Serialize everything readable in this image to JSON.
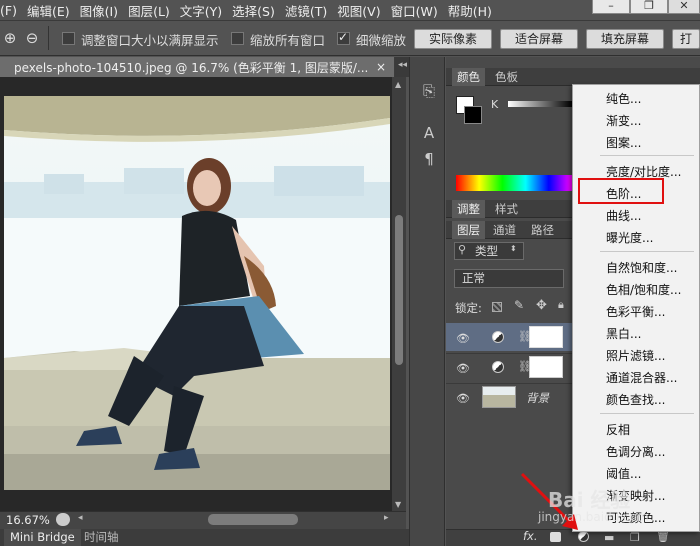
{
  "menubar": {
    "items": [
      "(F)",
      "编辑(E)",
      "图像(I)",
      "图层(L)",
      "文字(Y)",
      "选择(S)",
      "滤镜(T)",
      "视图(V)",
      "窗口(W)",
      "帮助(H)"
    ]
  },
  "window_buttons": [
    "–",
    "❐",
    "✕"
  ],
  "options_bar": {
    "resize_window_label": "调整窗口大小以满屏显示",
    "resize_window_checked": false,
    "zoom_all_label": "缩放所有窗口",
    "zoom_all_checked": false,
    "scrubby_zoom_label": "细微缩放",
    "scrubby_zoom_checked": true,
    "actual_pixels": "实际像素",
    "fit_screen": "适合屏幕",
    "fill_screen": "填充屏幕",
    "print_size": "打"
  },
  "document": {
    "tab_title": "pexels-photo-104510.jpeg @ 16.7% (色彩平衡 1, 图层蒙版/...",
    "close": "×",
    "zoom": "16.67%"
  },
  "bottom_tabs": [
    "Mini Bridge",
    "时间轴"
  ],
  "panels": {
    "color_tabs": [
      "颜色",
      "色板"
    ],
    "color_channel": "K",
    "adjust_tabs": [
      "调整",
      "样式"
    ],
    "layers_tabs": [
      "图层",
      "通道",
      "路径"
    ],
    "filter_kind": "类型",
    "blend_mode": "正常",
    "lock_label": "锁定:",
    "layers": [
      {
        "name": "",
        "type": "adjustment-with-mask",
        "selected": true
      },
      {
        "name": "",
        "type": "adjustment-with-mask",
        "selected": false
      },
      {
        "name": "背景",
        "type": "image",
        "selected": false
      }
    ],
    "footer_fx": "fx."
  },
  "adjustment_menu": {
    "groups": [
      [
        "纯色...",
        "渐变...",
        "图案..."
      ],
      [
        "亮度/对比度...",
        "色阶...",
        "曲线...",
        "曝光度..."
      ],
      [
        "自然饱和度...",
        "色相/饱和度...",
        "色彩平衡...",
        "黑白...",
        "照片滤镜...",
        "通道混合器...",
        "颜色查找..."
      ],
      [
        "反相",
        "色调分离...",
        "阈值...",
        "渐变映射...",
        "可选颜色..."
      ]
    ],
    "highlighted": "色阶..."
  },
  "watermark": {
    "logo": "Bai 经验",
    "sub": "jingyan.baidu.com"
  },
  "colors": {
    "highlight_box": "#e01010",
    "menu_bg": "#f2f2f2",
    "panel_bg": "#4a4a4a"
  }
}
